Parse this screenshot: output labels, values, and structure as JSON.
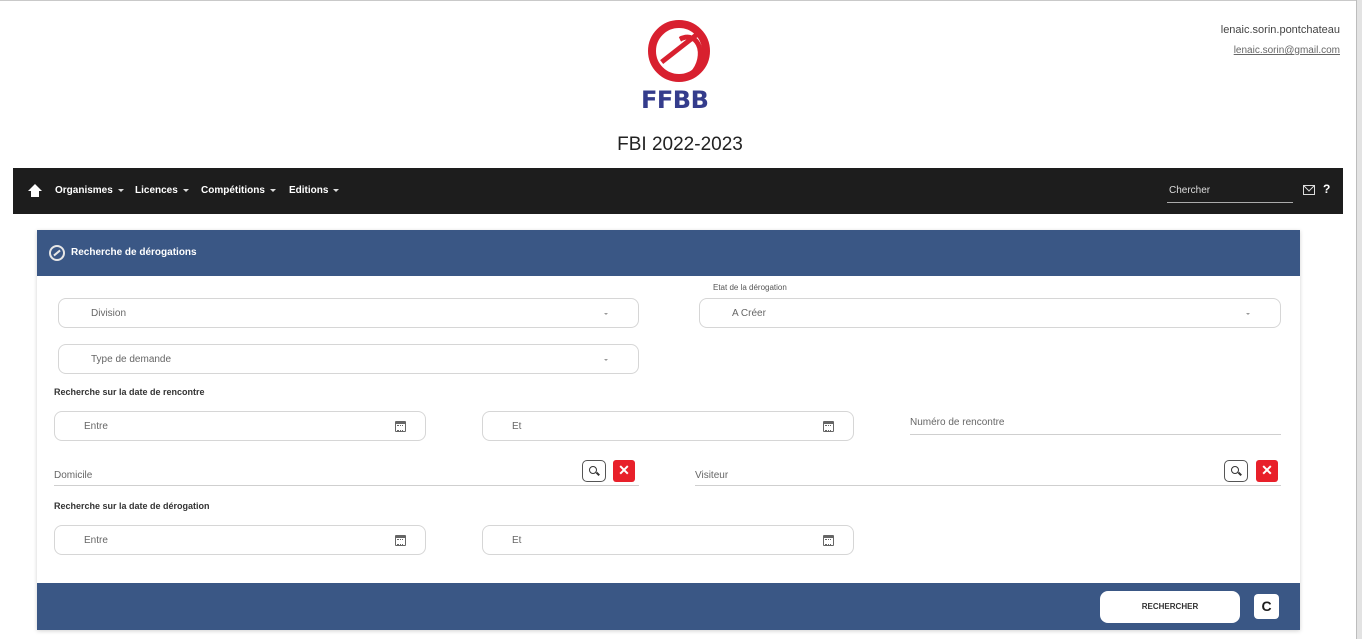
{
  "header": {
    "logo_text": "FFBB",
    "app_title": "FBI 2022-2023",
    "user_name": "lenaic.sorin.pontchateau",
    "user_email": "lenaic.sorin@gmail.com"
  },
  "navbar": {
    "items": [
      {
        "label": "Organismes"
      },
      {
        "label": "Licences"
      },
      {
        "label": "Compétitions"
      },
      {
        "label": "Editions"
      }
    ],
    "search_placeholder": "Chercher",
    "help_label": "?"
  },
  "panel": {
    "title": "Recherche de dérogations",
    "division_placeholder": "Division",
    "etat_label": "Etat de la dérogation",
    "etat_value": "A Créer",
    "type_placeholder": "Type de demande",
    "section_date_rencontre": "Recherche sur la date de rencontre",
    "entre_placeholder": "Entre",
    "et_placeholder": "Et",
    "numero_rencontre": "Numéro de rencontre",
    "domicile": "Domicile",
    "visiteur": "Visiteur",
    "clear_glyph": "✕",
    "section_date_derogation": "Recherche sur la date de dérogation"
  },
  "footer": {
    "search_button": "RECHERCHER",
    "reset_glyph": "C"
  }
}
